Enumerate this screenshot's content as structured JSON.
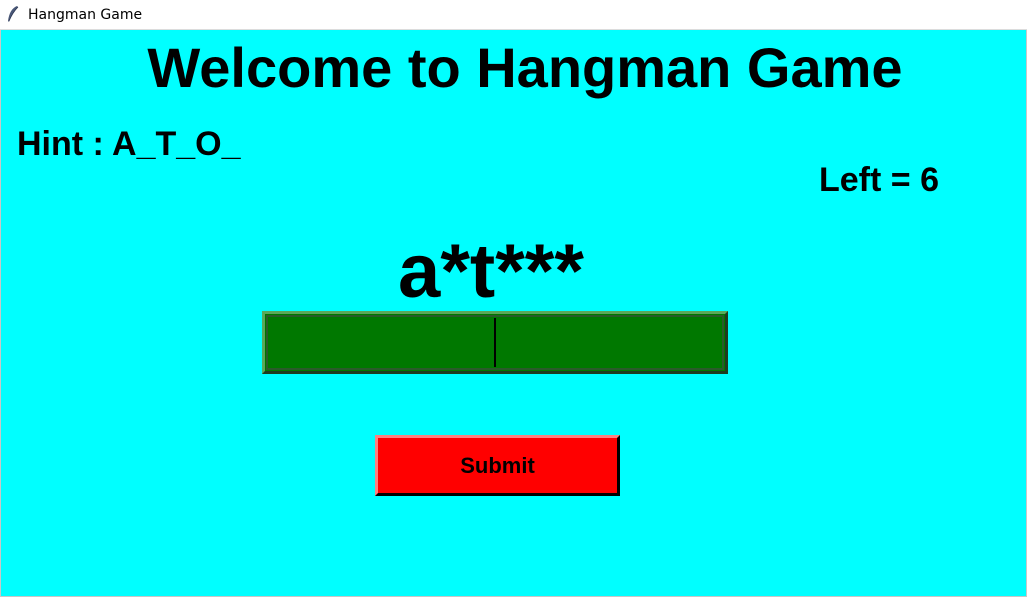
{
  "window": {
    "title": "Hangman Game",
    "icon": "feather-icon"
  },
  "game": {
    "heading": "Welcome to Hangman Game",
    "hint": "Hint : A_T_O_",
    "left": "Left = 6",
    "masked_word": "a*t***",
    "guess_value": "",
    "submit_label": "Submit"
  },
  "colors": {
    "background": "#00ffff",
    "input_fill": "#007800",
    "submit_fill": "#ff0000",
    "text": "#000000"
  }
}
